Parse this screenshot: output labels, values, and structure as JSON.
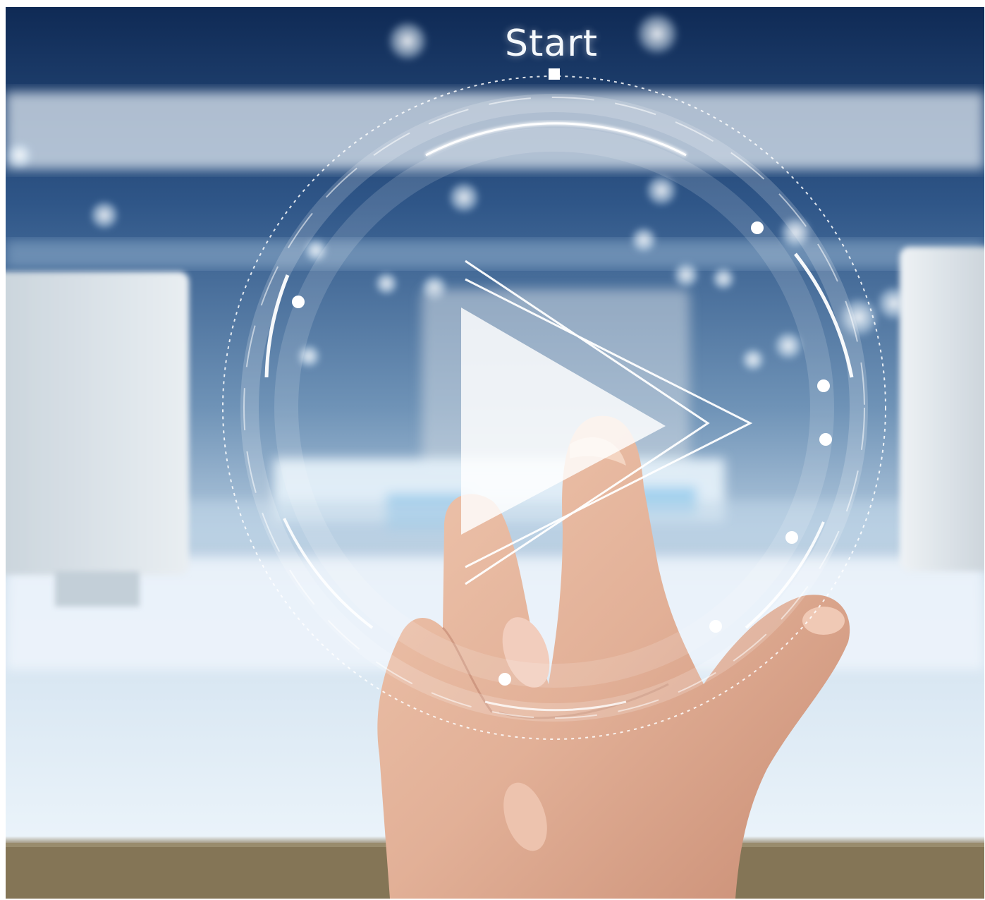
{
  "hud": {
    "start_label": "Start",
    "play_icon": "play-icon",
    "accent_color": "#ffffff"
  },
  "scene": {
    "background_tones": [
      "#0f2a55",
      "#6e94b8",
      "#e8f2f9",
      "#8a7c62"
    ],
    "skin_tone": "#e4b59c"
  }
}
